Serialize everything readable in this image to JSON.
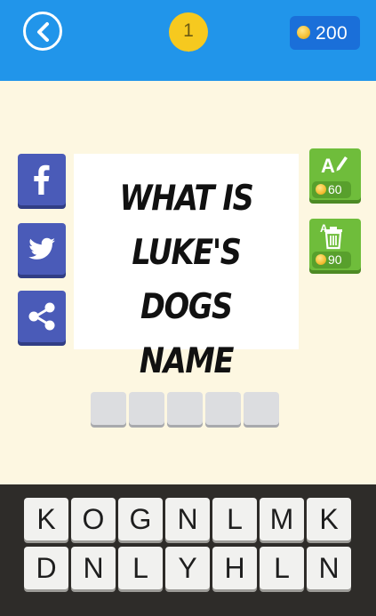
{
  "header": {
    "back_icon": "chevron-left-circle-icon",
    "level": "1",
    "coins": "200",
    "coin_icon": "coin-icon"
  },
  "share": [
    {
      "name": "facebook",
      "icon": "facebook-icon"
    },
    {
      "name": "twitter",
      "icon": "twitter-icon"
    },
    {
      "name": "share",
      "icon": "share-icon"
    }
  ],
  "clue": {
    "lines": [
      "WHAT IS",
      "LUKE'S DOGS",
      "NAME"
    ]
  },
  "hints": [
    {
      "name": "reveal-letter",
      "icon": "letter-a-pencil-icon",
      "cost": "60"
    },
    {
      "name": "remove-letters",
      "icon": "letter-a-trash-icon",
      "cost": "90"
    }
  ],
  "answer": {
    "slot_count": 5,
    "letters": [
      "",
      "",
      "",
      "",
      ""
    ]
  },
  "keyboard": {
    "row1": [
      "K",
      "O",
      "G",
      "N",
      "L",
      "M",
      "K"
    ],
    "row2": [
      "D",
      "N",
      "L",
      "Y",
      "H",
      "L",
      "N"
    ]
  },
  "colors": {
    "topbar": "#2195ea",
    "coin_pill": "#1a6fd9",
    "level_badge": "#f6c91f",
    "share_button": "#4a5bb8",
    "hint_button": "#6fbd3b",
    "background": "#fdf7e1",
    "keyboard_bg": "#2e2c29"
  }
}
